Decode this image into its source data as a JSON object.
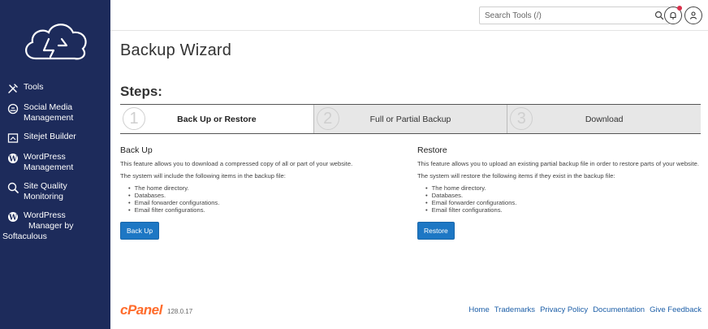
{
  "sidebar": {
    "items": [
      {
        "icon": "tools-icon",
        "lines": [
          "Tools"
        ]
      },
      {
        "icon": "social-media-icon",
        "lines": [
          "Social Media",
          "Management"
        ]
      },
      {
        "icon": "sitejet-icon",
        "lines": [
          "Sitejet Builder"
        ]
      },
      {
        "icon": "wordpress-icon",
        "lines": [
          "WordPress",
          "Management"
        ]
      },
      {
        "icon": "site-quality-icon",
        "lines": [
          "Site Quality",
          "Monitoring"
        ]
      },
      {
        "icon": "wordpress-icon",
        "lines": [
          "WordPress",
          "Manager by",
          "Softaculous"
        ]
      }
    ]
  },
  "topbar": {
    "search_placeholder": "Search Tools (/)"
  },
  "page": {
    "title": "Backup Wizard",
    "steps_title": "Steps:"
  },
  "steps": [
    {
      "num": "1",
      "label": "Back Up or Restore",
      "active": true
    },
    {
      "num": "2",
      "label": "Full or Partial Backup",
      "active": false
    },
    {
      "num": "3",
      "label": "Download",
      "active": false
    }
  ],
  "backup": {
    "heading": "Back Up",
    "desc": "This feature allows you to download a compressed copy of all or part of your website.",
    "intro": "The system will include the following items in the backup file:",
    "items": [
      "The home directory.",
      "Databases.",
      "Email forwarder configurations.",
      "Email filter configurations."
    ],
    "button": "Back Up"
  },
  "restore": {
    "heading": "Restore",
    "desc": "This feature allows you to upload an existing partial backup file in order to restore parts of your website.",
    "intro": "The system will restore the following items if they exist in the backup file:",
    "items": [
      "The home directory.",
      "Databases.",
      "Email forwarder configurations.",
      "Email filter configurations."
    ],
    "button": "Restore"
  },
  "footer": {
    "logo": "cPanel",
    "version": "128.0.17",
    "links": [
      "Home",
      "Trademarks",
      "Privacy Policy",
      "Documentation",
      "Give Feedback"
    ]
  },
  "colors": {
    "sidebar_bg": "#1d2b5b",
    "accent": "#1d77c4",
    "cpanel_orange": "#ff6c2c",
    "notification": "#d9304b"
  }
}
